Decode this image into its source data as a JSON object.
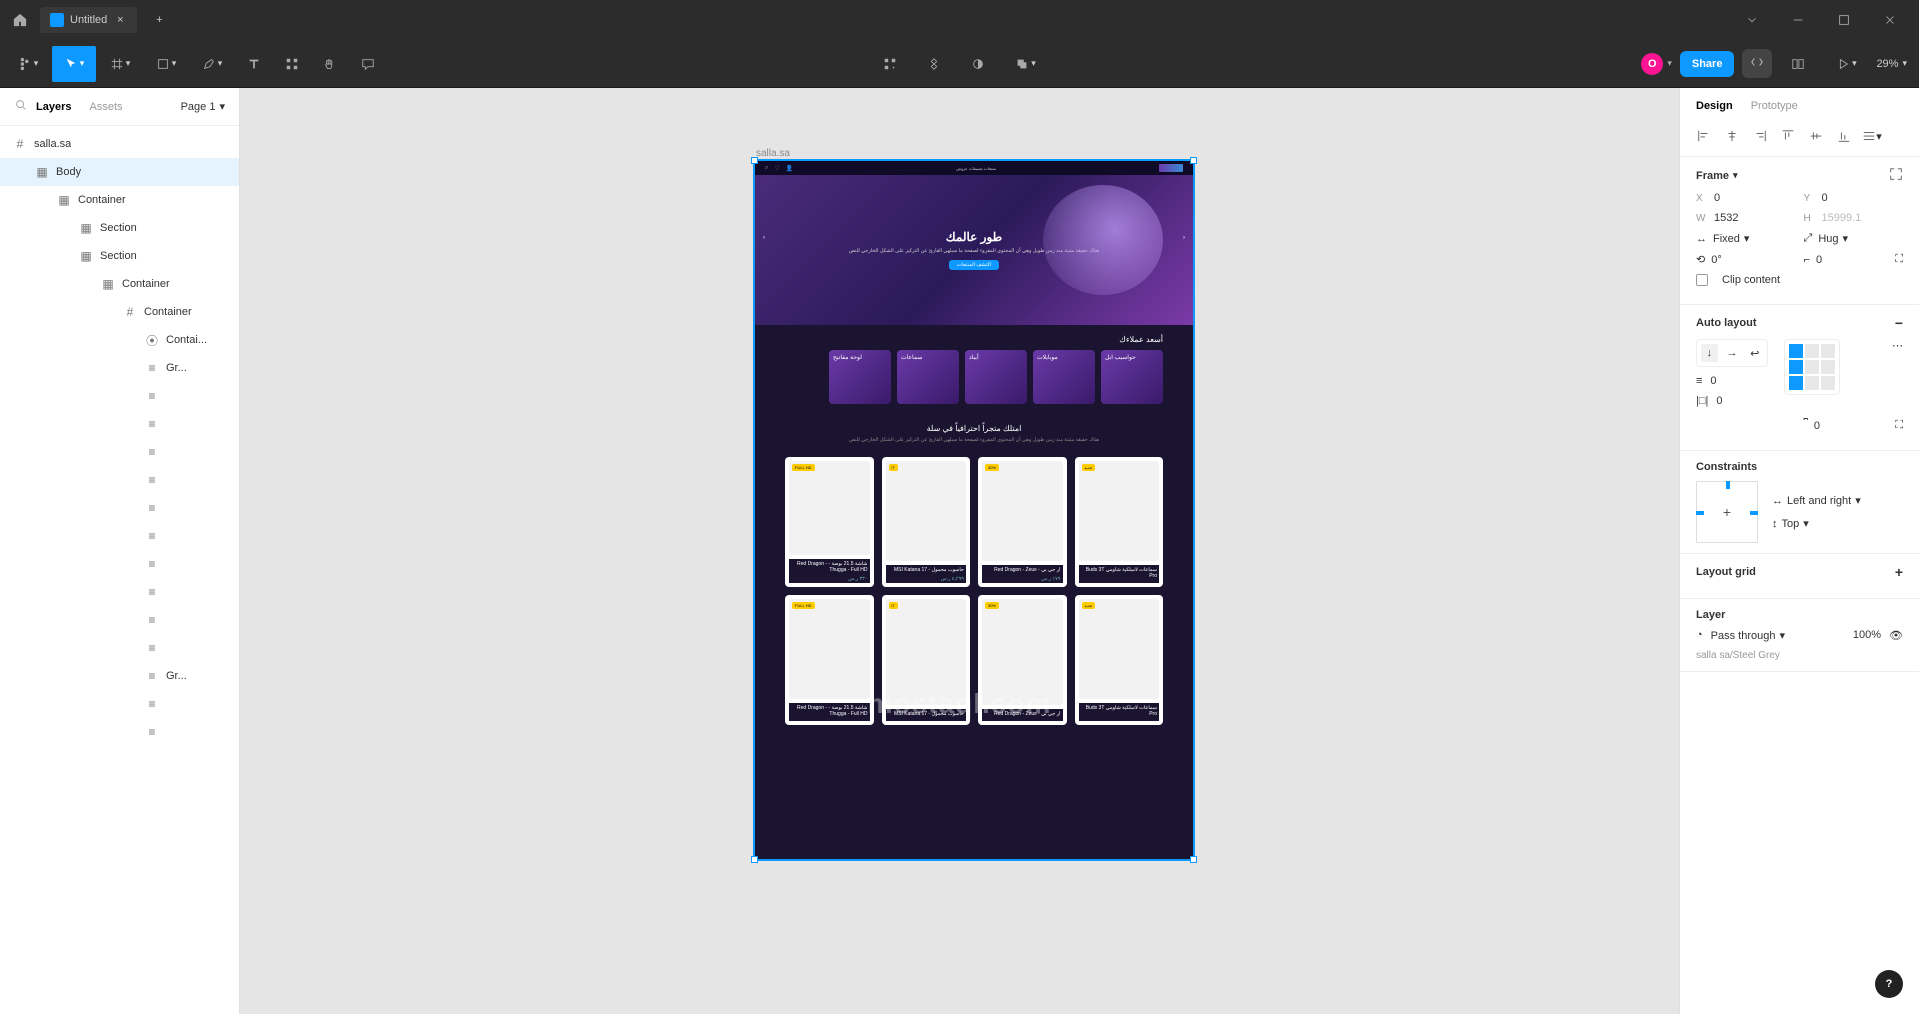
{
  "titlebar": {
    "tab_title": "Untitled"
  },
  "toolbar": {
    "share": "Share",
    "zoom": "29%",
    "avatar": "O"
  },
  "left_panel": {
    "tabs": {
      "layers": "Layers",
      "assets": "Assets"
    },
    "page": "Page 1",
    "layers": [
      {
        "icon": "frame",
        "label": "salla.sa",
        "indent": 0,
        "selected": false
      },
      {
        "icon": "frame-fill",
        "label": "Body",
        "indent": 1,
        "selected": true
      },
      {
        "icon": "frame-fill",
        "label": "Container",
        "indent": 2,
        "selected": false
      },
      {
        "icon": "frame-fill",
        "label": "Section",
        "indent": 3,
        "selected": false
      },
      {
        "icon": "frame-fill",
        "label": "Section",
        "indent": 3,
        "selected": false
      },
      {
        "icon": "frame-fill",
        "label": "Container",
        "indent": 4,
        "selected": false
      },
      {
        "icon": "frame",
        "label": "Container",
        "indent": 5,
        "selected": false
      },
      {
        "icon": "group",
        "label": "Contai...",
        "indent": 6,
        "selected": false
      },
      {
        "icon": "text",
        "label": "Gr...",
        "indent": 6,
        "selected": false
      },
      {
        "icon": "text",
        "label": "",
        "indent": 6,
        "selected": false
      },
      {
        "icon": "text",
        "label": "",
        "indent": 6,
        "selected": false
      },
      {
        "icon": "text",
        "label": "",
        "indent": 6,
        "selected": false
      },
      {
        "icon": "text",
        "label": "",
        "indent": 6,
        "selected": false
      },
      {
        "icon": "text",
        "label": "",
        "indent": 6,
        "selected": false
      },
      {
        "icon": "text",
        "label": "",
        "indent": 6,
        "selected": false
      },
      {
        "icon": "text",
        "label": "",
        "indent": 6,
        "selected": false
      },
      {
        "icon": "text",
        "label": "",
        "indent": 6,
        "selected": false
      },
      {
        "icon": "text",
        "label": "",
        "indent": 6,
        "selected": false
      },
      {
        "icon": "text",
        "label": "",
        "indent": 6,
        "selected": false
      },
      {
        "icon": "text",
        "label": "Gr...",
        "indent": 6,
        "selected": false
      },
      {
        "icon": "text",
        "label": "",
        "indent": 6,
        "selected": false
      },
      {
        "icon": "text",
        "label": "",
        "indent": 6,
        "selected": false
      }
    ]
  },
  "canvas": {
    "frame_label": "salla.sa",
    "hero_title": "طور عالمك",
    "hero_sub": "هناك حقيقة مثبتة منذ زمن طويل وهي أن المحتوى المقروء لصفحة ما سيلهي القارئ عن التركيز على الشكل الخارجي للنص",
    "hero_btn": "اكتشف المنتجات",
    "section_title": "أسعد عملاءك",
    "categories": [
      "لوحة مفاتيح",
      "سماعات",
      "أيباد",
      "موبايلات",
      "حواسيب ابل"
    ],
    "mid_title": "امتلك متجراً احترافياً في سلة",
    "mid_sub": "هناك حقيقة مثبتة منذ زمن طويل وهي أن المحتوى المقروء لصفحة ما سيلهي القارئ عن التركيز على الشكل الخارجي للنص",
    "products": [
      {
        "badge": "FULL HD",
        "name": "شاشة 21.5 بوصة - Red Dragon - Thugga - Full HD",
        "price": "٣٣٠ ر.س"
      },
      {
        "badge": "i7",
        "name": "حاسوب محمول - MSI Katana 17",
        "price": "٤,٢٩٩ ر.س"
      },
      {
        "badge": "30%",
        "name": "ار جي بي - Red Dragon - Zeus",
        "price": "١٧٩ ر.س"
      },
      {
        "badge": "جديد",
        "name": "سماعات لاسلكية شاومي Buds 3T Pro",
        "price": ""
      },
      {
        "badge": "FULL HD",
        "name": "شاشة 21.5 بوصة - Red Dragon - Thugga - Full HD",
        "price": ""
      },
      {
        "badge": "i7",
        "name": "حاسوب محمول - MSI Katana 17",
        "price": ""
      },
      {
        "badge": "30%",
        "name": "ار جي بي - Red Dragon - Zeus",
        "price": ""
      },
      {
        "badge": "جديد",
        "name": "سماعات لاسلكية شاومي Buds 3T Pro",
        "price": ""
      }
    ],
    "watermark": "mostaql.com"
  },
  "right_panel": {
    "tabs": {
      "design": "Design",
      "prototype": "Prototype"
    },
    "frame_label": "Frame",
    "x": "0",
    "y": "0",
    "w": "1532",
    "h": "15999.1",
    "w_mode": "Fixed",
    "h_mode": "Hug",
    "rotation": "0°",
    "radius": "0",
    "clip": "Clip content",
    "autolayout_title": "Auto layout",
    "gap": "0",
    "pad_h": "0",
    "pad_v": "0",
    "constraints_title": "Constraints",
    "constraint_h": "Left and right",
    "constraint_v": "Top",
    "layout_grid": "Layout grid",
    "layer_title": "Layer",
    "blend": "Pass through",
    "opacity": "100%",
    "salla_line": "salla sa/Steel Grey"
  }
}
